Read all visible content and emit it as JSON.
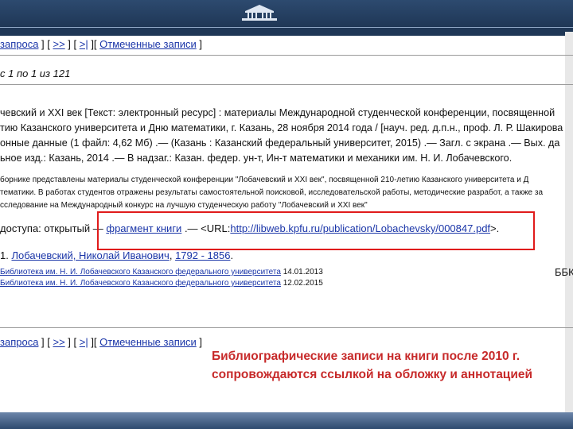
{
  "nav": {
    "b1": "запроса",
    "sep1": " ] [ ",
    "b2": ">>",
    "sep2": " ] [ ",
    "b3": ">|",
    "sep3": " ][ ",
    "b4": "Отмеченные записи",
    "end": " ]"
  },
  "result_count": "с 1 по 1 из 121",
  "record": {
    "l1": "чевский и XXI век [Текст: электронный ресурс] : материалы Международной студенческой конференции, посвященной",
    "l2": "тию Казанского университета и Дню математики, г. Казань, 28 ноября 2014 года / [науч. ред. д.п.н., проф. Л. Р. Шакирова",
    "l3": "онные данные (1 файл: 4,62 Мб) .— (Казань : Казанский федеральный университет, 2015) .— Загл. с экрана .— Вых. да",
    "l4": "ьное изд.: Казань, 2014 .— В надзаг.: Казан. федер. ун-т, Ин-т математики и механики им. Н. И. Лобачевского.",
    "s1": "борнике представлены материалы студенческой конференции \"Лобачевский и XXI век\", посвященной 210-летию Казанского университета и Д",
    "s2": "тематики. В работах студентов отражены результаты самостоятельной поисковой, исследовательской работы, методические разработ, а также за",
    "s3": "сследование на Международный конкурс на лучшую студенческую работу \"Лобачевский и XXI век\""
  },
  "access": {
    "label": "доступа: открытый",
    "dash": " — ",
    "link": "фрагмент книги",
    "mid": " .— <URL:",
    "url": "http://libweb.kpfu.ru/publication/Lobachevsky/000847.pdf",
    "end": ">."
  },
  "author": {
    "prefix": "1. ",
    "name": "Лобачевский, Николай Иванович",
    "sep": ", ",
    "years": "1792 - 1856",
    "end": "."
  },
  "holdings": [
    {
      "lib": "Библиотека им. Н. И. Лобачевского Казанского федерального университета",
      "date": "14.01.2013"
    },
    {
      "lib": "Библиотека им. Н. И. Лобачевского Казанского федерального университета",
      "date": "12.02.2015"
    }
  ],
  "bbk": "ББК",
  "caption": {
    "line1": "Библиографические записи на книги после 2010 г.",
    "line2": "сопровождаются ссылкой на обложку и аннотацией"
  },
  "colors": {
    "link": "#1a35a8",
    "highlight": "#e01b1b",
    "caption": "#c72a2a",
    "banner": "#1f3756"
  }
}
